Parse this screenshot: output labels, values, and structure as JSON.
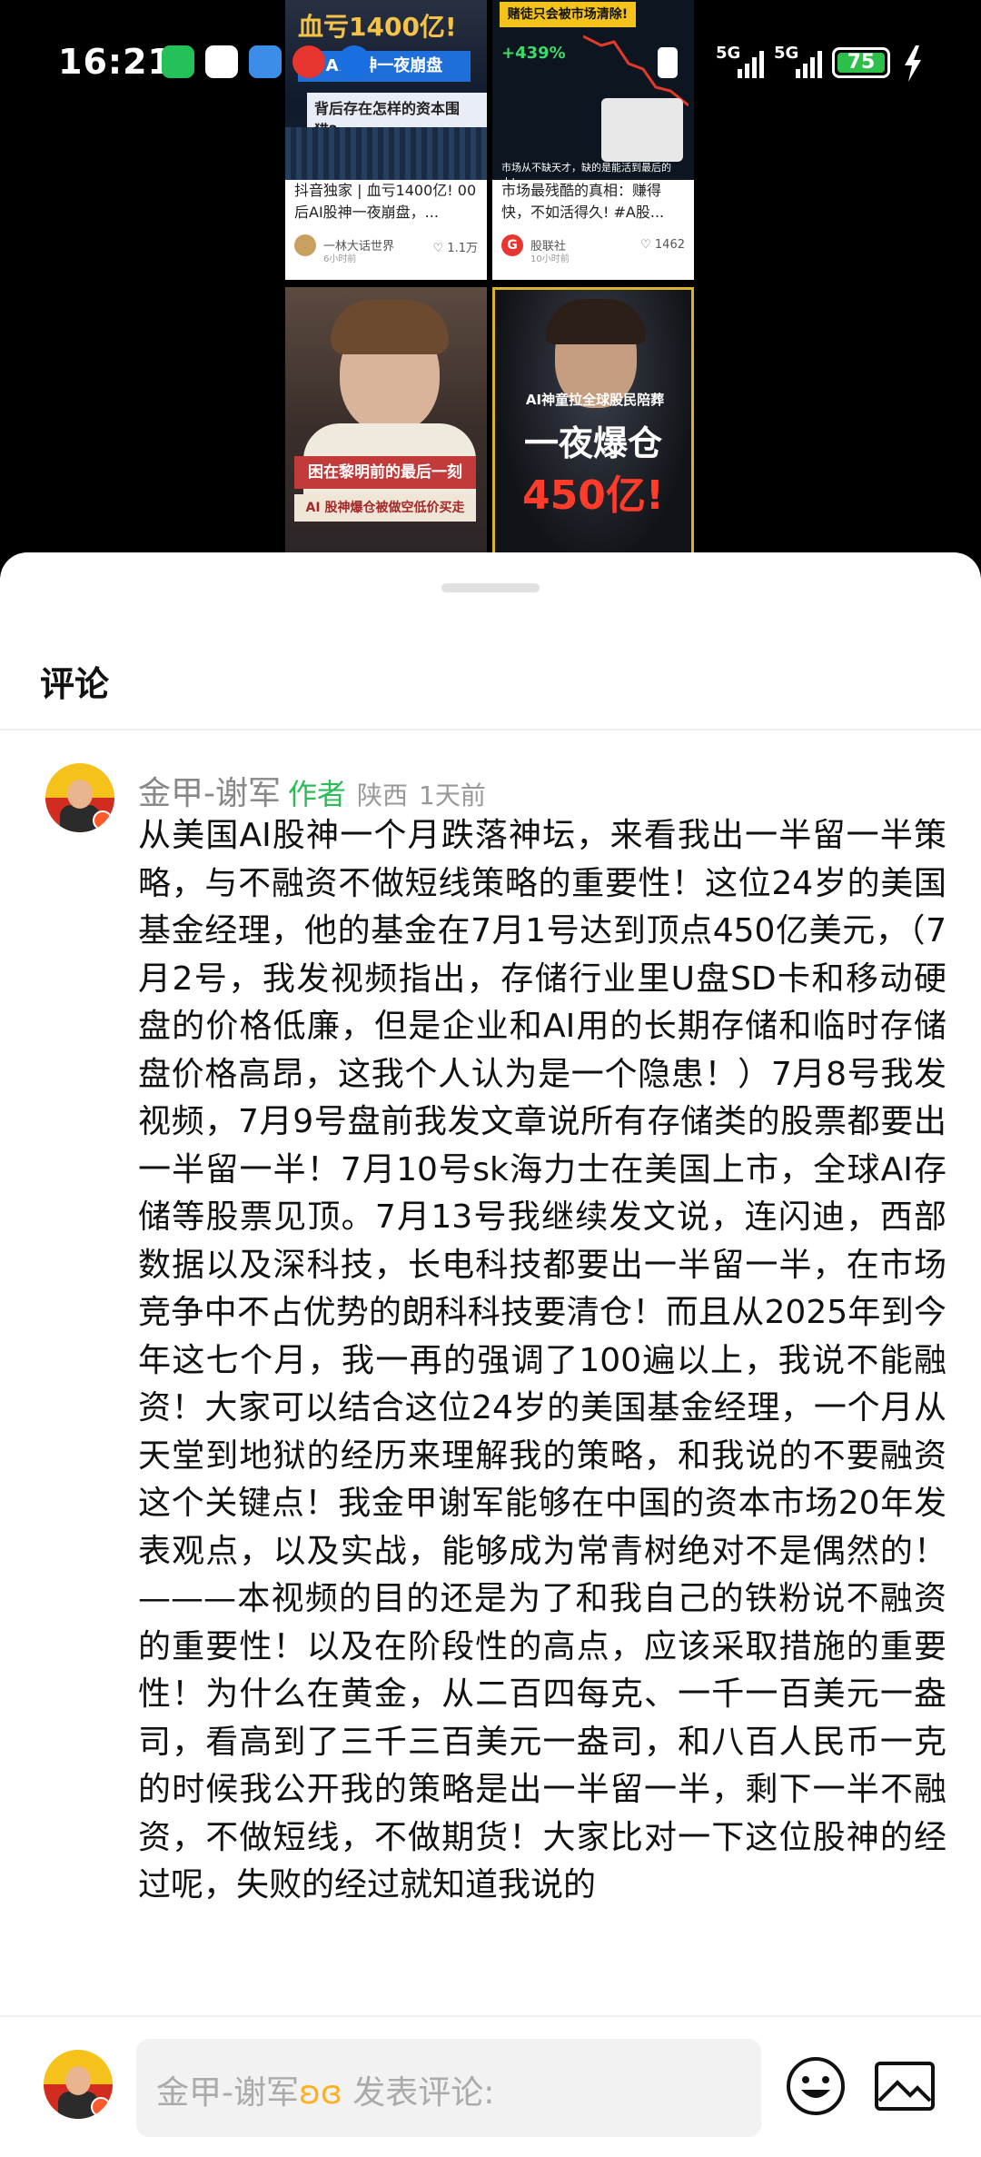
{
  "status_bar": {
    "time": "16:21",
    "network_1": "5G",
    "network_2": "5G",
    "battery": "75"
  },
  "feed": {
    "cards": [
      {
        "thumb_text_1": "血亏1400亿!",
        "thumb_text_2": "AI股神一夜崩盘",
        "thumb_text_3": "背后存在怎样的资本围猎?",
        "title": "抖音独家 | 血亏1400亿! 00后AI股神一夜崩盘，...",
        "author": "一林大话世界",
        "time": "6小时前",
        "likes": "1.1万"
      },
      {
        "thumb_text_1": "赌徒只会被市场清除!",
        "thumb_text_2": "+439%",
        "thumb_text_3": "市场从不缺天才，缺的是能活到最后的人!",
        "title": "市场最残酷的真相：赚得快，不如活得久! #A股...",
        "author": "股联社",
        "author_initial": "G",
        "time": "10小时前",
        "likes": "1462"
      },
      {
        "thumb_text_1": "困在黎明前的最后一刻",
        "thumb_text_2": "AI 股神爆仓被做空低价买走"
      },
      {
        "thumb_text_1": "AI神童拉全球股民陪葬",
        "thumb_text_2": "一夜爆仓",
        "thumb_text_3": "450亿!"
      }
    ]
  },
  "sheet": {
    "title": "评论"
  },
  "comment": {
    "author": "金甲-谢军",
    "tag": "作者",
    "location": "陕西",
    "time": "1天前",
    "body": "从美国AI股神一个月跌落神坛，来看我出一半留一半策略，与不融资不做短线策略的重要性！这位24岁的美国基金经理，他的基金在7月1号达到顶点450亿美元，（7月2号，我发视频指出，存储行业里U盘SD卡和移动硬盘的价格低廉，但是企业和AI用的长期存储和临时存储盘价格高昂，这我个人认为是一个隐患！）7月8号我发视频，7月9号盘前我发文章说所有存储类的股票都要出一半留一半！7月10号sk海力士在美国上市，全球AI存储等股票见顶。7月13号我继续发文说，连闪迪，西部数据以及深科技，长电科技都要出一半留一半，在市场竞争中不占优势的朗科科技要清仓！而且从2025年到今年这七个月，我一再的强调了100遍以上，我说不能融资！大家可以结合这位24岁的美国基金经理，一个月从天堂到地狱的经历来理解我的策略，和我说的不要融资这个关键点！我金甲谢军能够在中国的资本市场20年发表观点，以及实战，能够成为常青树绝对不是偶然的！———本视频的目的还是为了和我自己的铁粉说不融资的重要性！以及在阶段性的高点，应该采取措施的重要性！为什么在黄金，从二百四每克、一千一百美元一盎司，看高到了三千三百美元一盎司，和八百人民币一克的时候我公开我的策略是出一半留一半，剩下一半不融资，不做短线，不做期货！大家比对一下这位股神的经过呢，失败的经过就知道我说的"
  },
  "input": {
    "name": "金甲-谢军",
    "heart": "ʚɞ",
    "placeholder": "发表评论:"
  },
  "colors": {
    "accent_green": "#2dbb55",
    "battery_green": "#2dbf4a",
    "brand_orange": "#ffb020"
  }
}
